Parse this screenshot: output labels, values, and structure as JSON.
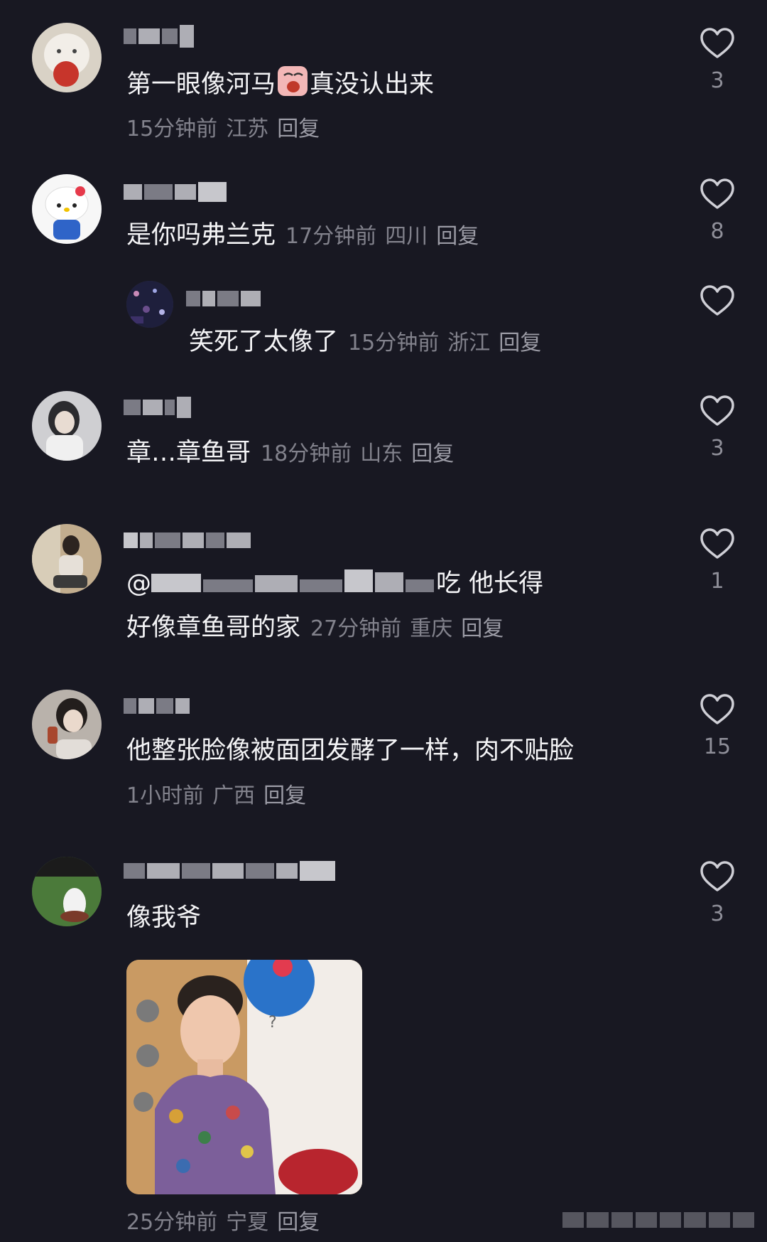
{
  "comments": [
    {
      "text_before_emoji": "第一眼像河马",
      "emoji": "crying-face-emoji",
      "text_after_emoji": "真没认出来",
      "time": "15分钟前",
      "location": "江苏",
      "reply": "回复",
      "likes": "3"
    },
    {
      "text": "是你吗弗兰克",
      "time": "17分钟前",
      "location": "四川",
      "reply": "回复",
      "likes": "8"
    },
    {
      "text": "笑死了太像了",
      "time": "15分钟前",
      "location": "浙江",
      "reply": "回复",
      "likes": ""
    },
    {
      "text": "章…章鱼哥",
      "time": "18分钟前",
      "location": "山东",
      "reply": "回复",
      "likes": "3"
    },
    {
      "mention_prefix": "@",
      "text_line1_tail": "吃 他长得",
      "text_line2": "好像章鱼哥的家",
      "time": "27分钟前",
      "location": "重庆",
      "reply": "回复",
      "likes": "1"
    },
    {
      "text": "他整张脸像被面团发酵了一样，肉不贴脸",
      "time": "1小时前",
      "location": "广西",
      "reply": "回复",
      "likes": "15"
    },
    {
      "text": "像我爷",
      "time": "25分钟前",
      "location": "宁夏",
      "reply": "回复",
      "likes": "3"
    }
  ],
  "icons": {
    "like": "heart-outline-icon"
  },
  "colors": {
    "background": "#181822",
    "primary_text": "#f4f4f6",
    "secondary_text": "#82828c"
  }
}
